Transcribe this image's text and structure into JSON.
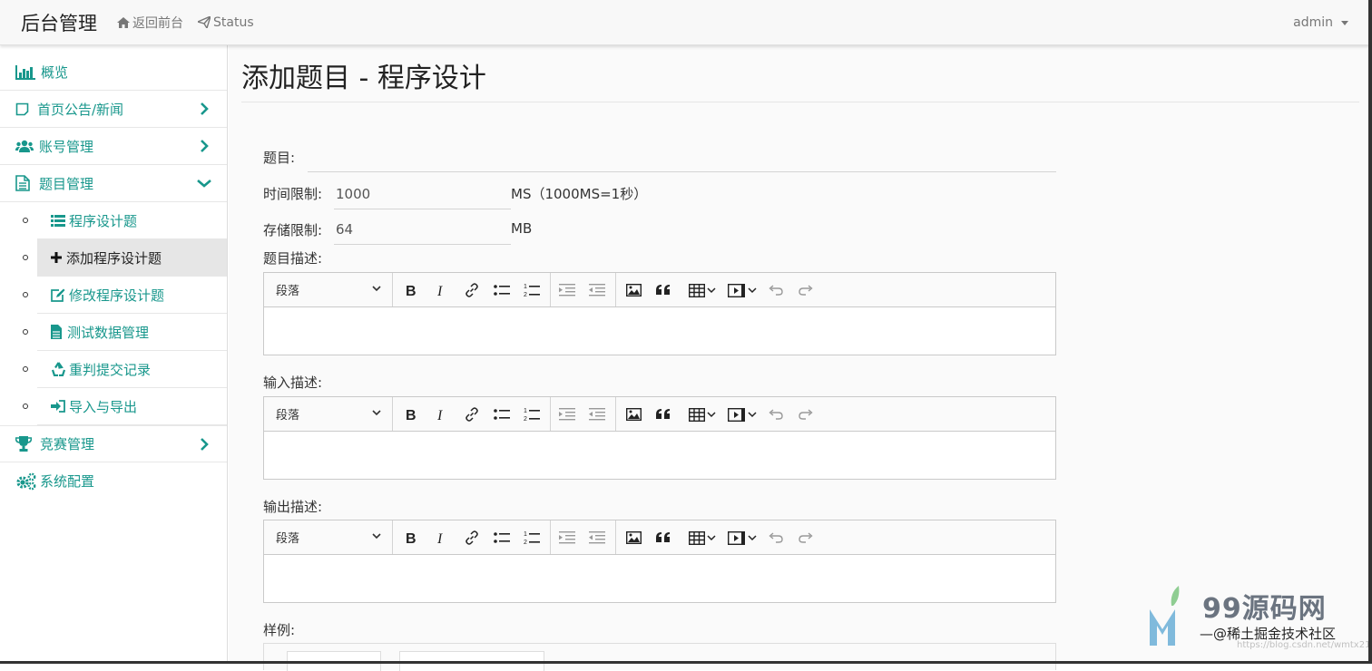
{
  "topbar": {
    "brand": "后台管理",
    "links": [
      {
        "label": "返回前台",
        "icon": "home-icon"
      },
      {
        "label": "Status",
        "icon": "send-icon"
      }
    ],
    "user": "admin"
  },
  "sidebar": {
    "items": [
      {
        "label": "概览",
        "icon": "bar-chart-icon"
      },
      {
        "label": "首页公告/新闻",
        "icon": "note-icon"
      },
      {
        "label": "账号管理",
        "icon": "users-icon"
      },
      {
        "label": "题目管理",
        "icon": "file-icon"
      }
    ],
    "subitems": [
      {
        "label": "程序设计题",
        "icon": "list-icon"
      },
      {
        "label": "添加程序设计题",
        "icon": "plus-icon",
        "active": true
      },
      {
        "label": "修改程序设计题",
        "icon": "edit-icon"
      },
      {
        "label": "测试数据管理",
        "icon": "document-icon"
      },
      {
        "label": "重判提交记录",
        "icon": "recycle-icon"
      },
      {
        "label": "导入与导出",
        "icon": "login-icon"
      }
    ],
    "bottom_items": [
      {
        "label": "竞赛管理",
        "icon": "trophy-icon"
      },
      {
        "label": "系统配置",
        "icon": "cogs-icon"
      }
    ]
  },
  "page": {
    "title": "添加题目 - 程序设计"
  },
  "form": {
    "title_label": "题目:",
    "title_value": "",
    "time_label": "时间限制:",
    "time_value": "1000",
    "time_unit": "MS（1000MS=1秒）",
    "memory_label": "存储限制:",
    "memory_value": "64",
    "memory_unit": "MB",
    "desc_label": "题目描述:",
    "input_label": "输入描述:",
    "output_label": "输出描述:",
    "sample_label": "样例:"
  },
  "editor": {
    "format_label": "段落"
  },
  "watermark": {
    "brand": "99源码网",
    "sub": "—@稀土掘金技术社区",
    "url": "https://blog.csdn.net/wmtx2121"
  },
  "colors": {
    "accent": "#18978c",
    "active_bg": "#e6e6e6"
  }
}
